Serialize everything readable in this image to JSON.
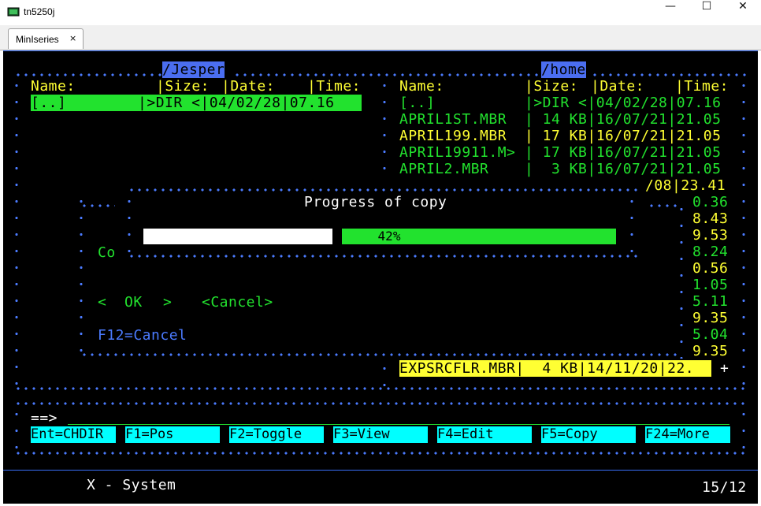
{
  "window": {
    "title": "tn5250j",
    "minimize": "—",
    "maximize": "☐",
    "close": "✕"
  },
  "tab": {
    "label": "MinIseries",
    "close": "×"
  },
  "left_panel": {
    "path": "/Jesper",
    "headers": {
      "name": "Name:",
      "size": "|Size: ",
      "date": "|Date:  ",
      "time": "|Time:"
    },
    "rows": [
      {
        "name": "[..]        ",
        "size": "|>DIR <",
        "date": "|04/02/28",
        "time": "|07.16"
      }
    ]
  },
  "right_panel": {
    "path": "/home",
    "headers": {
      "name": "Name:",
      "size": "|Size: ",
      "date": "|Date:  ",
      "time": "|Time:"
    },
    "rows": [
      {
        "name": "[..]",
        "size": "|>DIR <",
        "date": "|04/02/28",
        "time": "|07.16",
        "color": "green"
      },
      {
        "name": "APRIL1ST.MBR",
        "size": "| 14 KB",
        "date": "|16/07/21",
        "time": "|21.05",
        "color": "green"
      },
      {
        "name": "APRIL199.MBR",
        "size": "| 17 KB",
        "date": "|16/07/21",
        "time": "|21.05",
        "color": "yellow"
      },
      {
        "name": "APRIL19911.M>",
        "size": "| 17 KB",
        "date": "|16/07/21",
        "time": "|21.05",
        "color": "green"
      },
      {
        "name": "APRIL2.MBR  ",
        "size": "|  3 KB",
        "date": "|16/07/21",
        "time": "|21.05",
        "color": "green"
      }
    ],
    "partial_rows": [
      {
        "text": "/08|23.41",
        "color": "yellow"
      },
      {
        "text": "0.36",
        "color": "green"
      },
      {
        "text": "8.43",
        "color": "yellow"
      },
      {
        "text": "9.53",
        "color": "yellow"
      },
      {
        "text": "8.24",
        "color": "green"
      },
      {
        "text": "0.56",
        "color": "yellow"
      },
      {
        "text": "1.05",
        "color": "green"
      },
      {
        "text": "5.11",
        "color": "green"
      },
      {
        "text": "9.35",
        "color": "yellow"
      },
      {
        "text": "5.04",
        "color": "green"
      },
      {
        "text": "9.35",
        "color": "yellow"
      }
    ],
    "selected_row": "EXPSRCFLR.MBR|  4 KB|14/11/20|22.",
    "plus": "+"
  },
  "progress_dialog": {
    "title": "Progress of copy",
    "percent_label": "42%",
    "percent": 42
  },
  "confirm_dialog": {
    "partial_text": "Co",
    "ok_left": "<",
    "ok": "OK",
    "ok_right": ">",
    "cancel": "<Cancel>",
    "f12": "F12=Cancel"
  },
  "command": {
    "prompt": "==>"
  },
  "function_keys": [
    "Ent=CHDIR",
    "F1=Pos",
    "F2=Toggle",
    "F3=View",
    "F4=Edit",
    "F5=Copy",
    "F24=More"
  ],
  "status": {
    "system": "X - System",
    "cursor": "15/12"
  }
}
